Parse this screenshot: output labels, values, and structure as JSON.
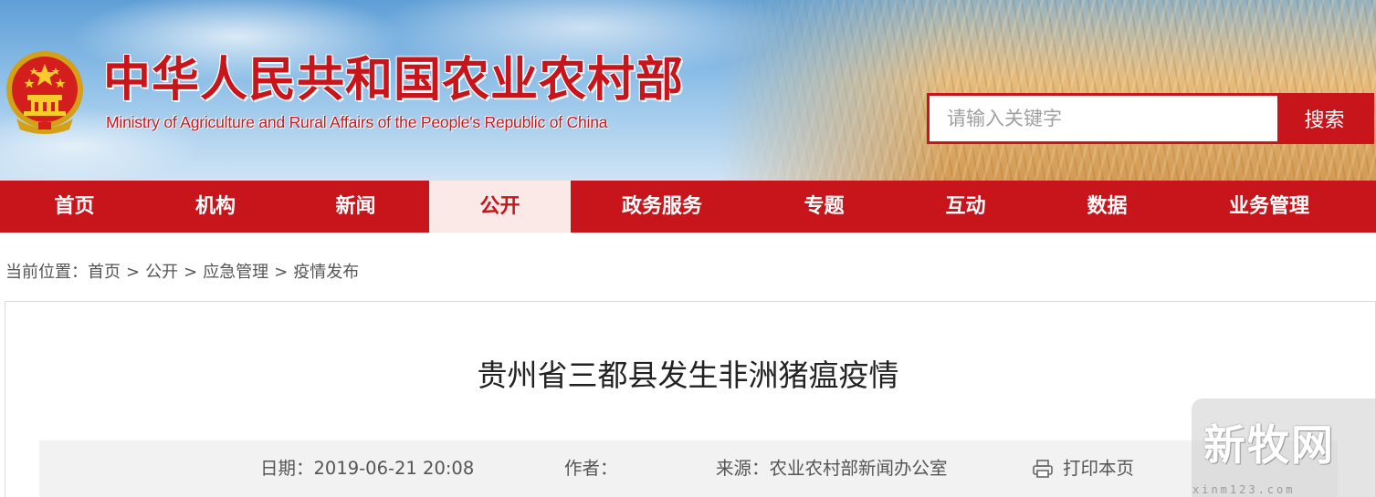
{
  "header": {
    "title": "中华人民共和国农业农村部",
    "subtitle": "Ministry of Agriculture and Rural Affairs of the People's Republic of China",
    "emblem_icon": "national-emblem-icon"
  },
  "search": {
    "placeholder": "请输入关键字",
    "value": "",
    "button_label": "搜索"
  },
  "nav": {
    "items": [
      {
        "label": "首页"
      },
      {
        "label": "机构"
      },
      {
        "label": "新闻"
      },
      {
        "label": "公开",
        "active": true
      },
      {
        "label": "政务服务"
      },
      {
        "label": "专题"
      },
      {
        "label": "互动"
      },
      {
        "label": "数据"
      },
      {
        "label": "业务管理"
      }
    ]
  },
  "breadcrumb": {
    "prefix": "当前位置：",
    "items": [
      "首页",
      "公开",
      "应急管理",
      "疫情发布"
    ],
    "separator": ">"
  },
  "article": {
    "title": "贵州省三都县发生非洲猪瘟疫情",
    "date_label": "日期：",
    "date_value": "2019-06-21 20:08",
    "author_label": "作者：",
    "author_value": "",
    "source_label": "来源：",
    "source_value": "农业农村部新闻办公室",
    "print_label": "打印本页",
    "print_icon": "printer-icon"
  },
  "watermark": {
    "text": "新牧网",
    "url": "xinm123.com"
  },
  "colors": {
    "brand_red": "#c8141b",
    "nav_active_bg": "#fbe9e7",
    "meta_bar_bg": "#f2f2f2"
  }
}
